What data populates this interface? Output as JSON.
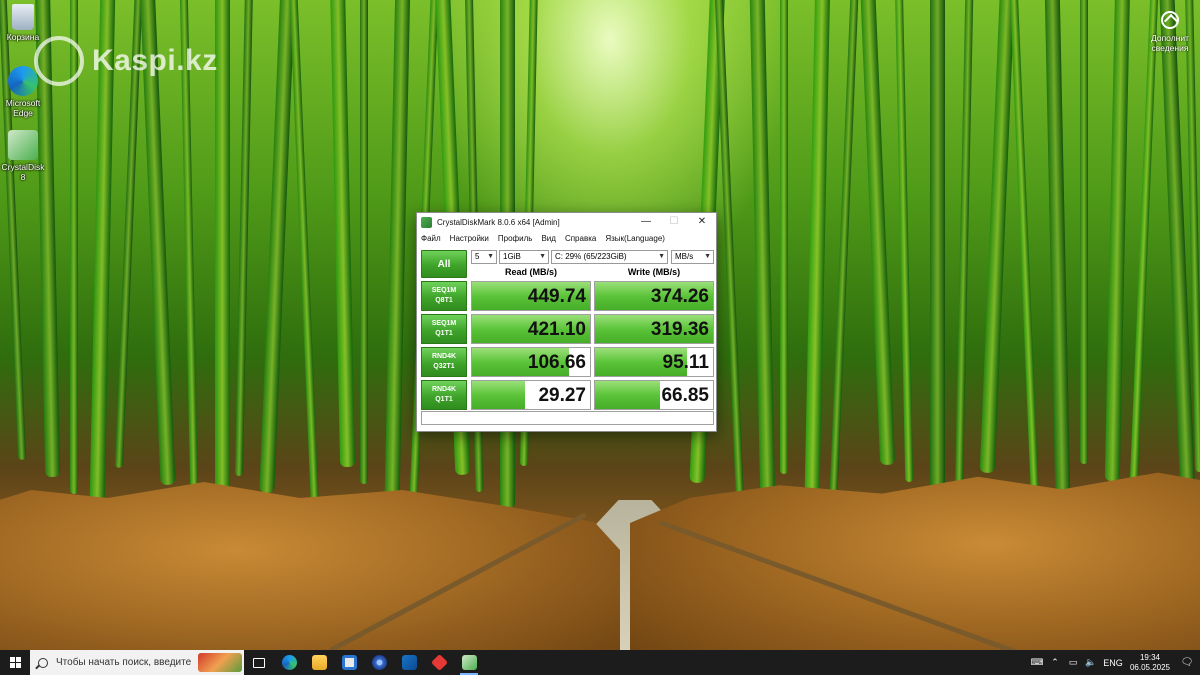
{
  "desktop": {
    "icons": [
      {
        "label": "Корзина",
        "icon": "recycle-bin-icon"
      },
      {
        "label": "Microsoft Edge",
        "icon": "edge-icon"
      },
      {
        "label": "CrystalDisk 8",
        "icon": "crystaldisk-icon"
      }
    ],
    "watermark": "Kaspi.kz",
    "side_notification": "Дополнит сведения"
  },
  "window": {
    "title": "CrystalDiskMark 8.0.6 x64 [Admin]",
    "controls": {
      "minimize": "—",
      "maximize": "☐",
      "close": "✕"
    },
    "menu": [
      "Файл",
      "Настройки",
      "Профиль",
      "Вид",
      "Справка",
      "Язык(Language)"
    ],
    "all_button": "All",
    "count": "5",
    "size": "1GiB",
    "drive": "C: 29% (65/223GiB)",
    "unit": "MB/s",
    "read_header": "Read (MB/s)",
    "write_header": "Write (MB/s)",
    "rows": [
      {
        "label1": "SEQ1M",
        "label2": "Q8T1",
        "read": "449.74",
        "write": "374.26",
        "read_fill": 1.0,
        "write_fill": 1.0
      },
      {
        "label1": "SEQ1M",
        "label2": "Q1T1",
        "read": "421.10",
        "write": "319.36",
        "read_fill": 1.0,
        "write_fill": 1.0
      },
      {
        "label1": "RND4K",
        "label2": "Q32T1",
        "read": "106.66",
        "write": "95.11",
        "read_fill": 0.82,
        "write_fill": 0.78
      },
      {
        "label1": "RND4K",
        "label2": "Q1T1",
        "read": "29.27",
        "write": "66.85",
        "read_fill": 0.45,
        "write_fill": 0.55
      }
    ]
  },
  "taskbar": {
    "search_placeholder": "Чтобы начать поиск, введите",
    "apps": [
      "task-view-icon",
      "edge-icon",
      "file-explorer-icon",
      "store-icon",
      "chrome-like-icon",
      "outlook-icon",
      "anydesk-icon",
      "crystaldisk-icon"
    ],
    "tray": {
      "language": "ENG",
      "time": "19:34",
      "date": "06.05.2025"
    }
  },
  "colors": {
    "accent_green": "#3fa42a",
    "bar_green": "#5cc43a",
    "taskbar": "#1c1c1c"
  }
}
